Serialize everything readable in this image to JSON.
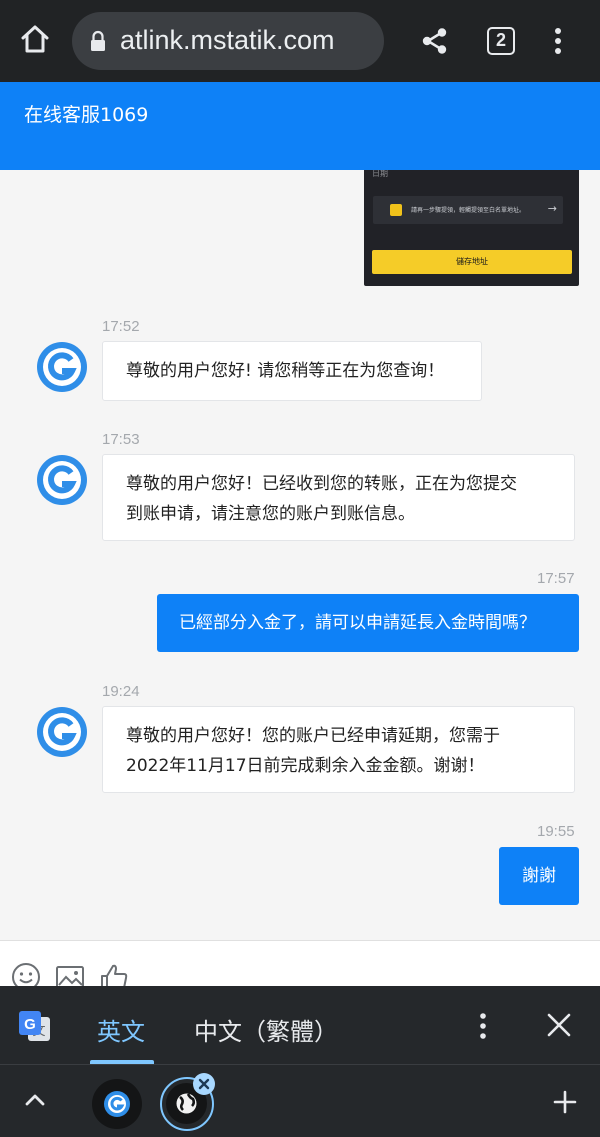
{
  "browser": {
    "url": "atlink.mstatik.com",
    "tab_count": "2"
  },
  "chat": {
    "title": "在线客服1069",
    "image_message": {
      "date_label": "日期",
      "notice_text": "請再一步驟提領，輕觸提領至白名單地址。",
      "button_label": "儲存地址"
    },
    "messages": [
      {
        "time": "17:52",
        "from": "agent",
        "text": "尊敬的用户您好! 请您稍等正在为您查询！"
      },
      {
        "time": "17:53",
        "from": "agent",
        "line1": "尊敬的用户您好！已经收到您的转账，正在为您提交",
        "line2": "到账申请，请注意您的账户到账信息。"
      },
      {
        "time": "17:57",
        "from": "user",
        "text": "已經部分入金了，請可以申請延長入金時間嗎？"
      },
      {
        "time": "19:24",
        "from": "agent",
        "line1": "尊敬的用户您好！您的账户已经申请延期，您需于",
        "line2": "2022年11月17日前完成剩余入金金额。谢谢！"
      },
      {
        "time": "19:55",
        "from": "user",
        "text": "謝謝"
      }
    ]
  },
  "toolbar": {
    "icons": [
      "emoji-icon",
      "image-icon",
      "thumbs-up-icon"
    ]
  },
  "translate": {
    "tab_source": "英文",
    "tab_target": "中文（繁體）"
  },
  "colors": {
    "accent_blue": "#0e81f7",
    "bar_dark": "#25282b",
    "active_tab": "#7fc7ff"
  }
}
